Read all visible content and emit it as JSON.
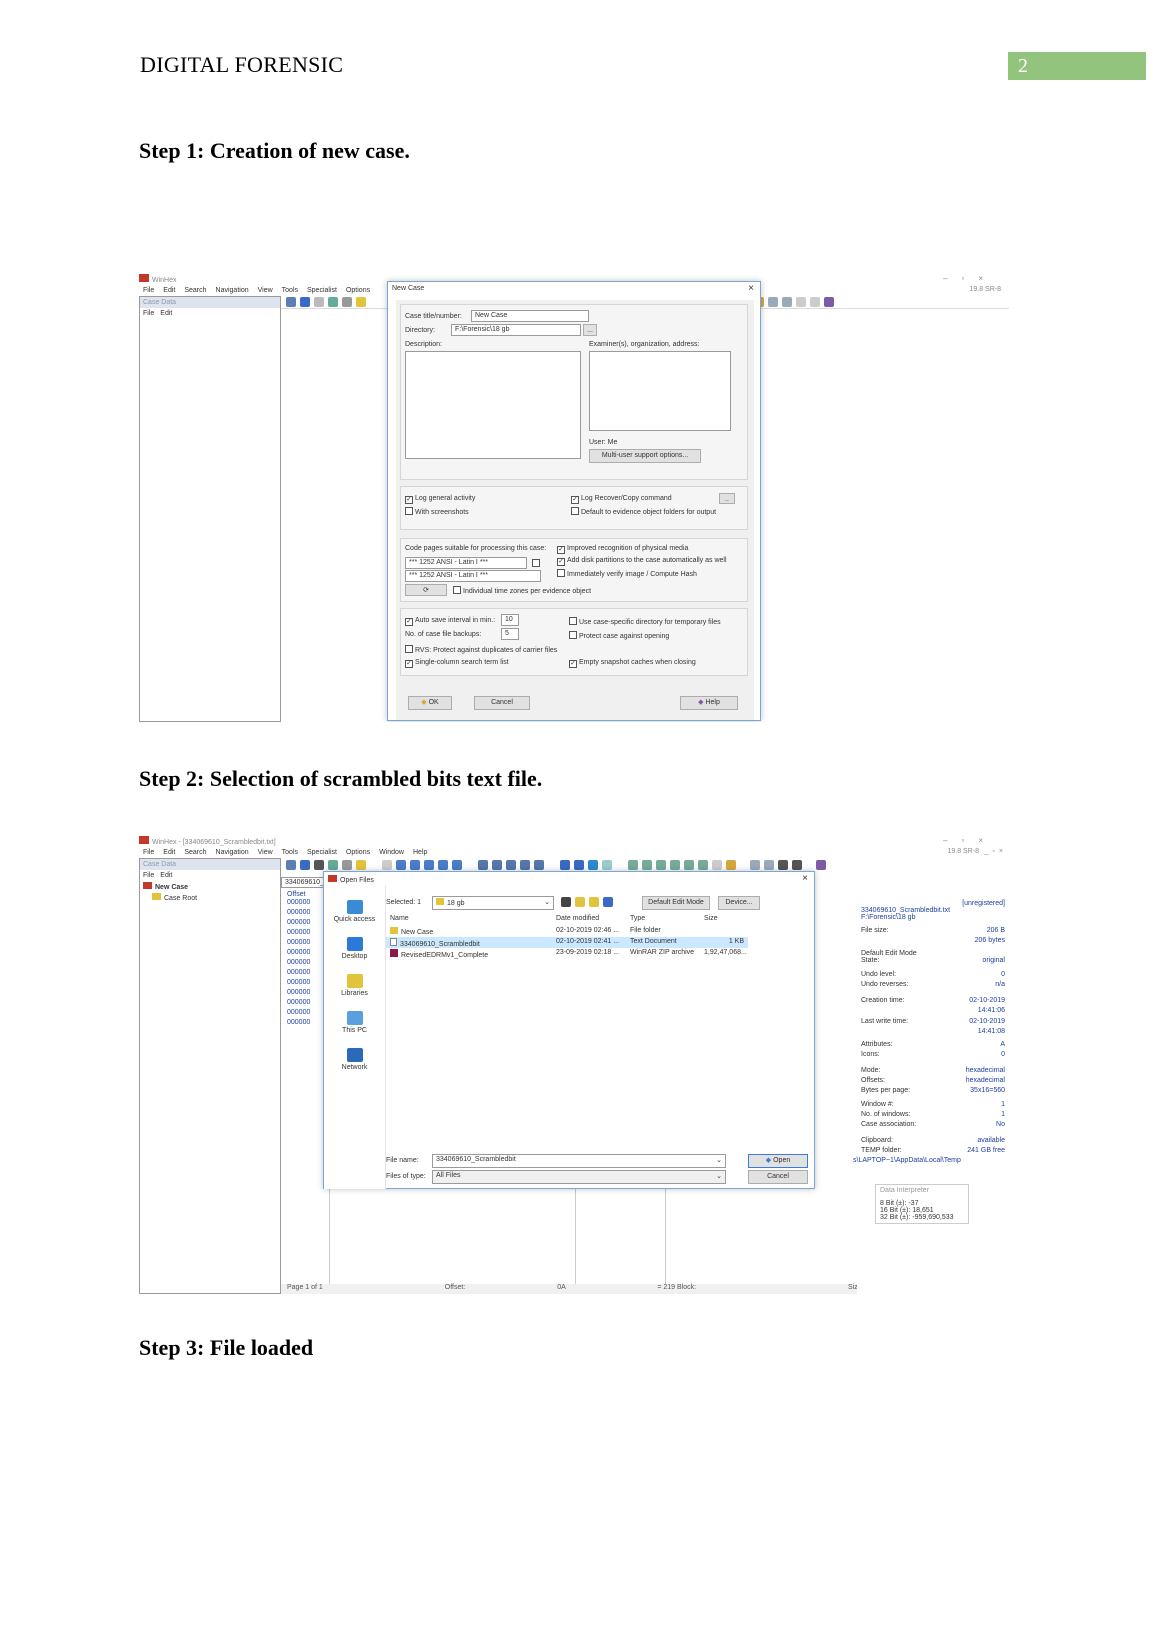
{
  "header": {
    "title": "DIGITAL FORENSIC",
    "page_number": "2"
  },
  "steps": [
    {
      "label": "Step 1: Creation of new case."
    },
    {
      "label": "Step 2: Selection of scrambled bits text file."
    },
    {
      "label": "Step 3: File loaded"
    }
  ],
  "shot1": {
    "app_title": "WinHex",
    "version": "19.8 SR-8",
    "menu": [
      "File",
      "Edit",
      "Search",
      "Navigation",
      "View",
      "Tools",
      "Specialist",
      "Options"
    ],
    "case_data_label": "Case Data",
    "panel_menu": [
      "File",
      "Edit"
    ],
    "dialog": {
      "title": "New Case",
      "case_title_label": "Case title/number:",
      "case_title_value": "New Case",
      "directory_label": "Directory:",
      "directory_value": "F:\\Forensic\\18 gb",
      "browse": "...",
      "description_label": "Description:",
      "examiner_label": "Examiner(s), organization, address:",
      "user_label": "User: Me",
      "multi_user": "Multi-user support options...",
      "log_general": "Log general activity",
      "with_screenshots": "With screenshots",
      "log_recover": "Log Recover/Copy command",
      "default_evidence": "Default to evidence object folders for output",
      "code_pages_label": "Code pages suitable for processing this case:",
      "code_page_1": "*** 1252  ANSI - Latin I ***",
      "code_page_2": "*** 1252  ANSI - Latin I ***",
      "improved_recognition": "Improved recognition of physical media",
      "add_disk_partitions": "Add disk partitions to the case automatically as well",
      "verify_image": "Immediately verify image / Compute Hash",
      "individual_tz": "Individual time zones per evidence object",
      "auto_save_label": "Auto save interval in min.:",
      "auto_save_value": "10",
      "backups_label": "No. of case file backups:",
      "backups_value": "5",
      "rvs_protect": "RVS: Protect against duplicates of carrier files",
      "single_column": "Single-column search term list",
      "case_specific_dir": "Use case-specific directory for temporary files",
      "protect_opening": "Protect case against opening",
      "empty_snapshot": "Empty snapshot caches when closing",
      "ok": "OK",
      "cancel": "Cancel",
      "help": "Help"
    }
  },
  "shot2": {
    "app_title": "WinHex - [334069610_Scrambledbit.txt]",
    "version": "19.8 SR-8",
    "menu": [
      "File",
      "Edit",
      "Search",
      "Navigation",
      "View",
      "Tools",
      "Specialist",
      "Options",
      "Window",
      "Help"
    ],
    "case_data_label": "Case Data",
    "panel_menu": [
      "File",
      "Edit"
    ],
    "tree": [
      "New Case",
      "Case Root"
    ],
    "doc_tab": "334069610_Scrambledbit.t...",
    "offset_label": "Offset",
    "hex_rows": [
      "000000",
      "000000",
      "000000",
      "000000",
      "000000",
      "000000",
      "000000",
      "000000",
      "000000",
      "000000",
      "000000",
      "000000",
      "000000"
    ],
    "status": {
      "page": "Page 1 of 1",
      "offset": "Offset:",
      "offset_value": "0A",
      "sel": "= 219  Block:",
      "size_label": "Size:"
    },
    "open_dialog": {
      "title": "Open Files",
      "selected_label": "Selected: 1",
      "folder": "18 gb",
      "default_edit_mode": "Default Edit Mode",
      "device": "Device...",
      "nav": [
        "Quick access",
        "Desktop",
        "Libraries",
        "This PC",
        "Network"
      ],
      "columns": [
        "Name",
        "Date modified",
        "Type",
        "Size"
      ],
      "rows": [
        {
          "name": "New Case",
          "date": "02-10-2019 02:46 ...",
          "type": "File folder",
          "size": ""
        },
        {
          "name": "334069610_Scrambledbit",
          "date": "02-10-2019 02:41 ...",
          "type": "Text Document",
          "size": "1 KB"
        },
        {
          "name": "RevisedEDRMv1_Complete",
          "date": "23-09-2019 02:18 ...",
          "type": "WinRAR ZIP archive",
          "size": "1,92,47,068..."
        }
      ],
      "file_name_label": "File name:",
      "file_name_value": "334069610_Scrambledbit",
      "files_of_type_label": "Files of type:",
      "files_of_type_value": "All Files",
      "open": "Open",
      "cancel": "Cancel"
    },
    "info": {
      "unregistered": "[unregistered]",
      "file_name": "334069610_Scrambledbit.txt",
      "path": "F:\\Forensic\\18 gb",
      "file_size_label": "File size:",
      "file_size": "206 B",
      "file_size_bytes": "206 bytes",
      "default_edit_mode": "Default Edit Mode",
      "state_label": "State:",
      "state": "original",
      "undo_level_label": "Undo level:",
      "undo_level": "0",
      "undo_reverses_label": "Undo reverses:",
      "undo_reverses": "n/a",
      "creation_label": "Creation time:",
      "creation_date": "02-10-2019",
      "creation_time": "14:41:06",
      "write_label": "Last write time:",
      "write_date": "02-10-2019",
      "write_time": "14:41:08",
      "attributes_label": "Attributes:",
      "attributes": "A",
      "icons_label": "Icons:",
      "icons": "0",
      "mode_label": "Mode:",
      "mode": "hexadecimal",
      "offsets_label": "Offsets:",
      "offsets": "hexadecimal",
      "bpp_label": "Bytes per page:",
      "bpp": "35x16=560",
      "window_label": "Window #:",
      "window": "1",
      "nwin_label": "No. of windows:",
      "nwin": "1",
      "assoc_label": "Case association:",
      "assoc": "No",
      "clipboard_label": "Clipboard:",
      "clipboard": "available",
      "temp_label": "TEMP folder:",
      "temp": "241 GB free",
      "temp_path": "s\\LAPTOP~1\\AppData\\Local\\Temp",
      "interpreter_title": "Data Interpreter",
      "bit8": "8 Bit (±): -37",
      "bit16": "16 Bit (±): 18,651",
      "bit32": "32 Bit (±): -959,690,533"
    }
  },
  "colors": {
    "accent_green": "#93c47d",
    "dialog_border": "#7aa7d9",
    "select_blue": "#cce8ff",
    "link_blue": "#1a3fa0"
  }
}
